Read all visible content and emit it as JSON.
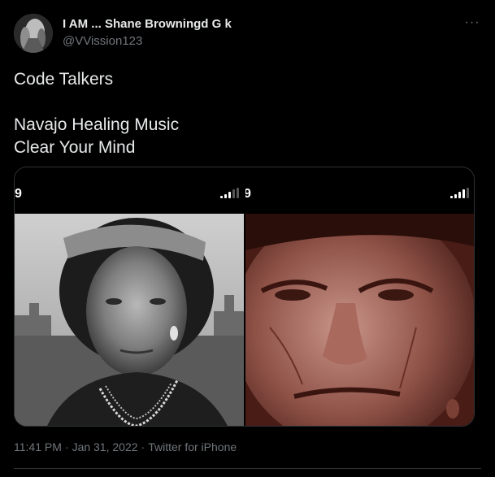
{
  "author": {
    "display_name": "I AM ... Shane Browningd G k",
    "handle": "@VVission123",
    "more_label": "···"
  },
  "tweet": {
    "line1": "Code Talkers",
    "line2": "Navajo Healing Music",
    "line3": "Clear Your Mind"
  },
  "media": {
    "left_status_num": "9",
    "right_status_num": "9"
  },
  "meta": {
    "time": "11:41 PM",
    "separator": "·",
    "date": "Jan 31, 2022",
    "source": "Twitter for iPhone"
  }
}
